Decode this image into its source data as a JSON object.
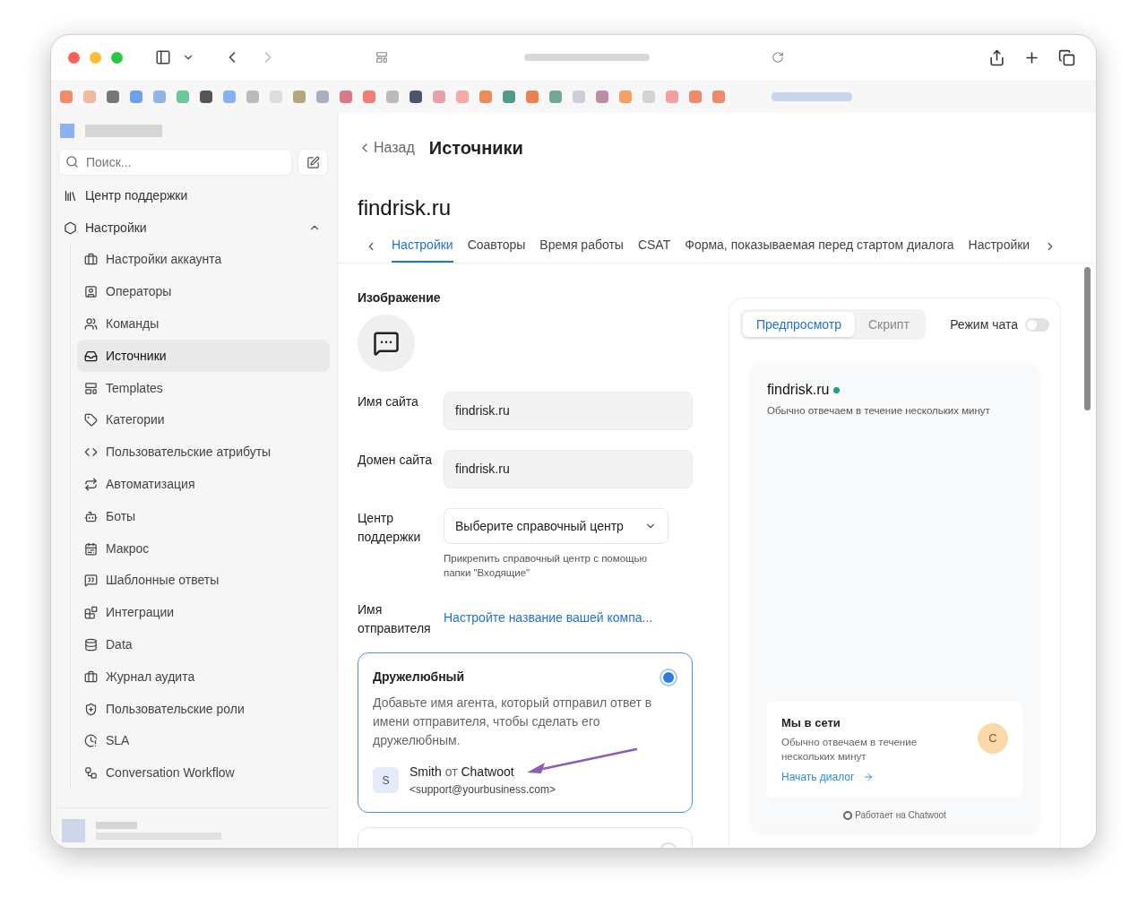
{
  "sidebar": {
    "search": {
      "placeholder": "Поиск..."
    },
    "items": [
      {
        "label": "Центр поддержки"
      },
      {
        "label": "Настройки",
        "expanded": true,
        "children": [
          {
            "label": "Настройки аккаунта",
            "selected": false
          },
          {
            "label": "Операторы",
            "selected": false
          },
          {
            "label": "Команды",
            "selected": false
          },
          {
            "label": "Источники",
            "selected": true
          },
          {
            "label": "Templates",
            "selected": false
          },
          {
            "label": "Категории",
            "selected": false
          },
          {
            "label": "Пользовательские атрибуты",
            "selected": false
          },
          {
            "label": "Автоматизация",
            "selected": false
          },
          {
            "label": "Боты",
            "selected": false
          },
          {
            "label": "Макрос",
            "selected": false
          },
          {
            "label": "Шаблонные ответы",
            "selected": false
          },
          {
            "label": "Интеграции",
            "selected": false
          },
          {
            "label": "Data",
            "selected": false
          },
          {
            "label": "Журнал аудита",
            "selected": false
          },
          {
            "label": "Пользовательские роли",
            "selected": false
          },
          {
            "label": "SLA",
            "selected": false
          },
          {
            "label": "Conversation Workflow",
            "selected": false
          }
        ]
      }
    ]
  },
  "header": {
    "back": "Назад",
    "title": "Источники"
  },
  "inbox": {
    "name": "findrisk.ru"
  },
  "tabs": [
    {
      "label": "Настройки",
      "selected": true
    },
    {
      "label": "Соавторы",
      "selected": false
    },
    {
      "label": "Время работы",
      "selected": false
    },
    {
      "label": "CSAT",
      "selected": false
    },
    {
      "label": "Форма, показываемая перед стартом диалога",
      "selected": false
    },
    {
      "label": "Настройки",
      "selected": false
    }
  ],
  "form": {
    "image_label": "Изображение",
    "fields": [
      {
        "kind": "input",
        "label": "Имя сайта",
        "value": "findrisk.ru"
      },
      {
        "kind": "input",
        "label": "Домен сайта",
        "value": "findrisk.ru"
      },
      {
        "kind": "select",
        "label": "Центр поддержки",
        "value": "Выберите справочный центр",
        "help": "Прикрепить справочный центр с помощью папки \"Входящие\""
      },
      {
        "kind": "link",
        "label": "Имя отправителя",
        "value": "Настройте название вашей компа..."
      }
    ],
    "sender_options": [
      {
        "title": "Дружелюбный",
        "selected": true,
        "description": "Добавьте имя агента, который отправил ответ в имени отправителя, чтобы сделать его дружелюбным.",
        "avatar": "S",
        "agent": "Smith",
        "joiner": "от",
        "business": "Chatwoot",
        "email": "<support@yourbusiness.com>"
      },
      {
        "selected": false
      }
    ]
  },
  "preview": {
    "tabs": [
      {
        "label": "Предпросмотр",
        "selected": true
      },
      {
        "label": "Скрипт",
        "selected": false
      }
    ],
    "chat_mode": {
      "label": "Режим чата",
      "on": false
    },
    "widget": {
      "title": "findrisk.ru",
      "online": true,
      "subtitle": "Обычно отвечаем в течение нескольких минут",
      "card": {
        "title": "Мы в сети",
        "text": "Обычно отвечаем в течение нескольких минут",
        "avatar": "C",
        "action": "Начать диалог"
      },
      "footer": "Работает на Chatwoot"
    }
  }
}
